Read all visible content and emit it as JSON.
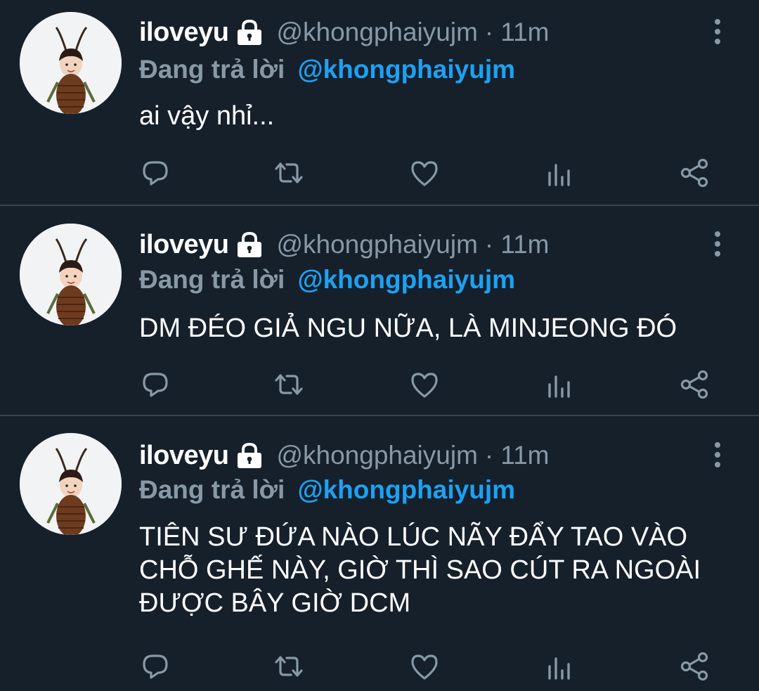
{
  "colors": {
    "background": "#15202b",
    "divider": "#38444d",
    "text_primary": "#ffffff",
    "text_secondary": "#8899a6",
    "accent": "#1da1f2"
  },
  "tweets": [
    {
      "display_name": "iloveyu",
      "handle": "@khongphaiyujm",
      "separator": "·",
      "time": "11m",
      "reply_label": "Đang trả lời",
      "reply_handle": "@khongphaiyujm",
      "text": "ai vậy nhỉ...",
      "icons": {
        "protected": "lock-icon",
        "more": "more-vertical-icon"
      }
    },
    {
      "display_name": "iloveyu",
      "handle": "@khongphaiyujm",
      "separator": "·",
      "time": "11m",
      "reply_label": "Đang trả lời",
      "reply_handle": "@khongphaiyujm",
      "text": "DM ĐÉO GIẢ NGU NỮA, LÀ MINJEONG ĐÓ",
      "icons": {
        "protected": "lock-icon",
        "more": "more-vertical-icon"
      }
    },
    {
      "display_name": "iloveyu",
      "handle": "@khongphaiyujm",
      "separator": "·",
      "time": "11m",
      "reply_label": "Đang trả lời",
      "reply_handle": "@khongphaiyujm",
      "text": "TIÊN SƯ ĐỨA NÀO LÚC NÃY ĐẨY TAO VÀO CHỖ GHẾ NÀY, GIỜ THÌ SAO CÚT RA NGOÀI ĐƯỢC BÂY GIỜ DCM",
      "icons": {
        "protected": "lock-icon",
        "more": "more-vertical-icon"
      }
    }
  ],
  "action_icons": [
    "reply-icon",
    "retweet-icon",
    "like-icon",
    "views-icon",
    "share-icon"
  ]
}
